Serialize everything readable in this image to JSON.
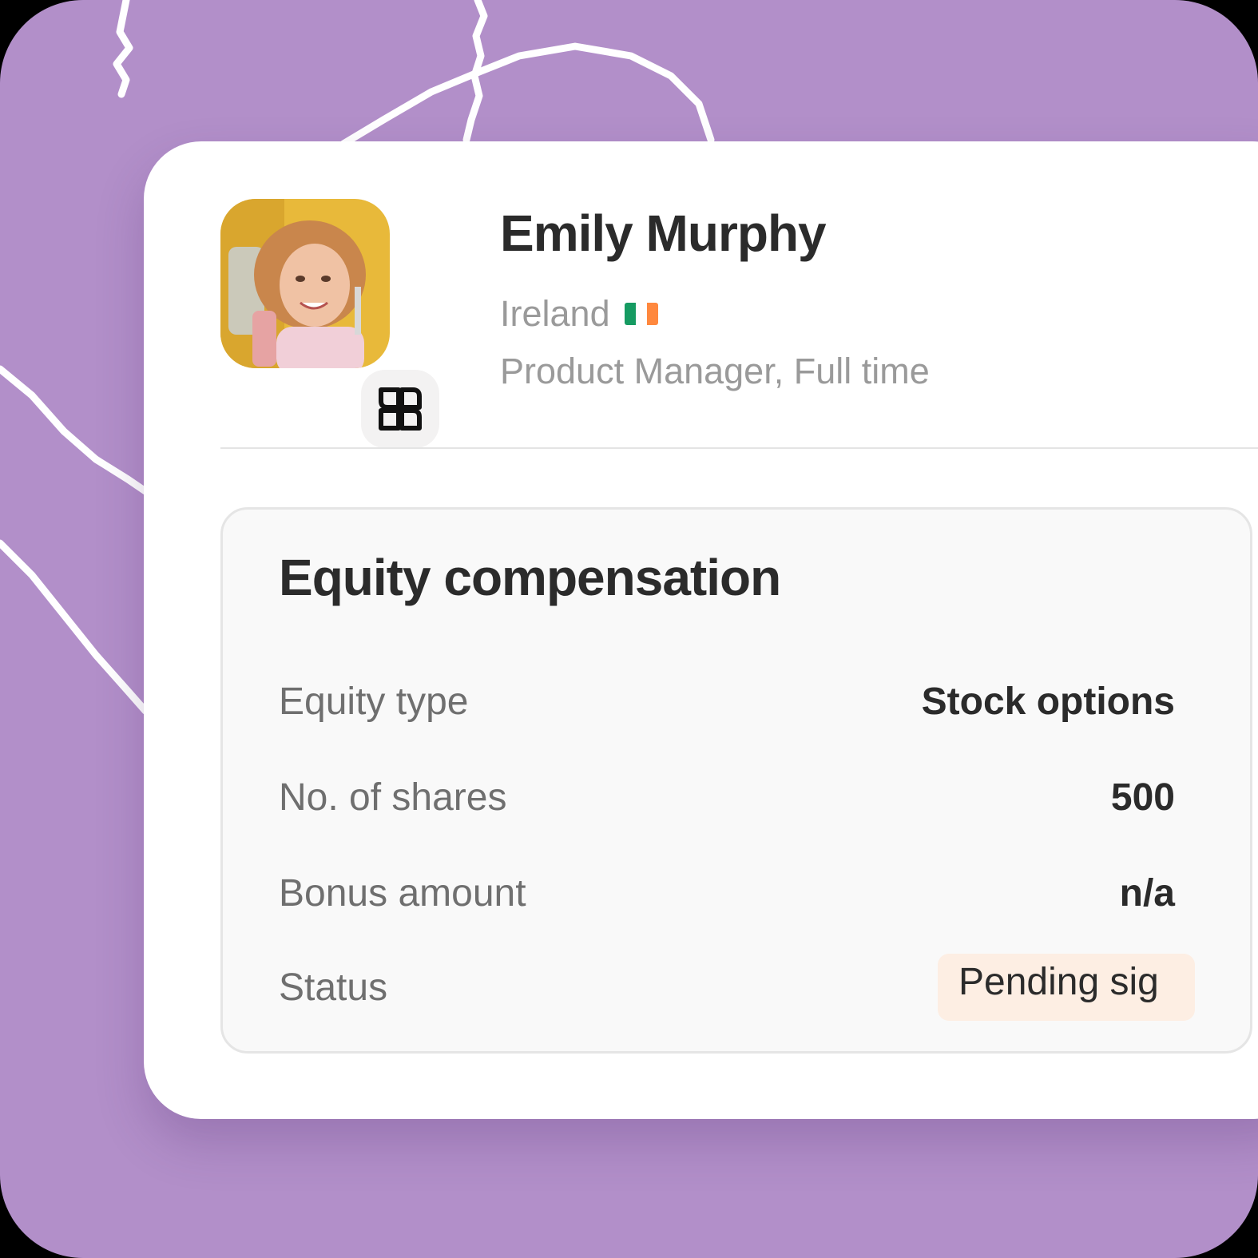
{
  "profile": {
    "name": "Emily Murphy",
    "country": "Ireland",
    "flag_colors": [
      "#169b62",
      "#ffffff",
      "#ff883e"
    ],
    "job": "Product Manager, Full time",
    "badge_icon": "company-logo-icon"
  },
  "equity": {
    "title": "Equity compensation",
    "rows": [
      {
        "label": "Equity type",
        "value": "Stock options"
      },
      {
        "label": "No. of shares",
        "value": "500"
      },
      {
        "label": "Bonus amount",
        "value": "n/a"
      },
      {
        "label": "Status",
        "value": "Pending sig"
      }
    ]
  },
  "colors": {
    "background": "#b28fc9",
    "card": "#ffffff",
    "panel": "#f9f9f9",
    "status_pill": "#fdeee3"
  }
}
